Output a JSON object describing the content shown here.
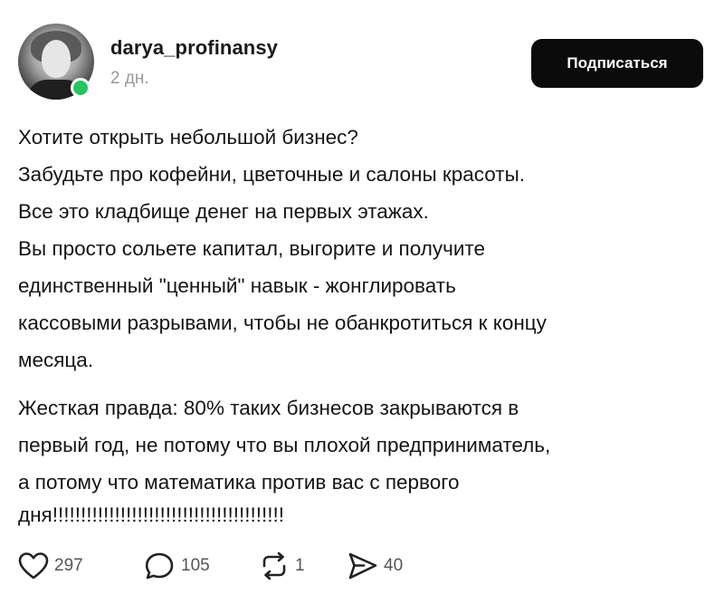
{
  "post": {
    "author": {
      "username": "darya_profinansy",
      "timestamp": "2 дн.",
      "online": true
    },
    "subscribe_label": "Подписаться",
    "paragraphs": [
      {
        "lines": [
          "Хотите открыть небольшой бизнес?",
          "Забудьте про кофейни, цветочные и салоны красоты.",
          "Все это кладбище денег на первых этажах.",
          "Вы просто сольете капитал, выгорите и получите",
          "единственный \"ценный\" навык - жонглировать",
          "кассовыми разрывами, чтобы не обанкротиться к концу",
          "месяца."
        ]
      },
      {
        "lines": [
          "Жесткая правда: 80% таких бизнесов закрываются в",
          "первый год, не потому что вы плохой предприниматель,",
          "а потому что математика против вас с первого",
          "дня!!!!!!!!!!!!!!!!!!!!!!!!!!!!!!!!!!!!!!!!!"
        ]
      }
    ],
    "actions": {
      "likes": {
        "icon": "heart-icon",
        "count": "297"
      },
      "comments": {
        "icon": "comment-icon",
        "count": "105"
      },
      "reposts": {
        "icon": "repost-icon",
        "count": "1"
      },
      "shares": {
        "icon": "share-icon",
        "count": "40"
      }
    }
  },
  "colors": {
    "background": "#ffffff",
    "text": "#141414",
    "muted": "#9a9a9a",
    "button_bg": "#0b0b0b",
    "button_text": "#ffffff",
    "online": "#22c55e"
  }
}
